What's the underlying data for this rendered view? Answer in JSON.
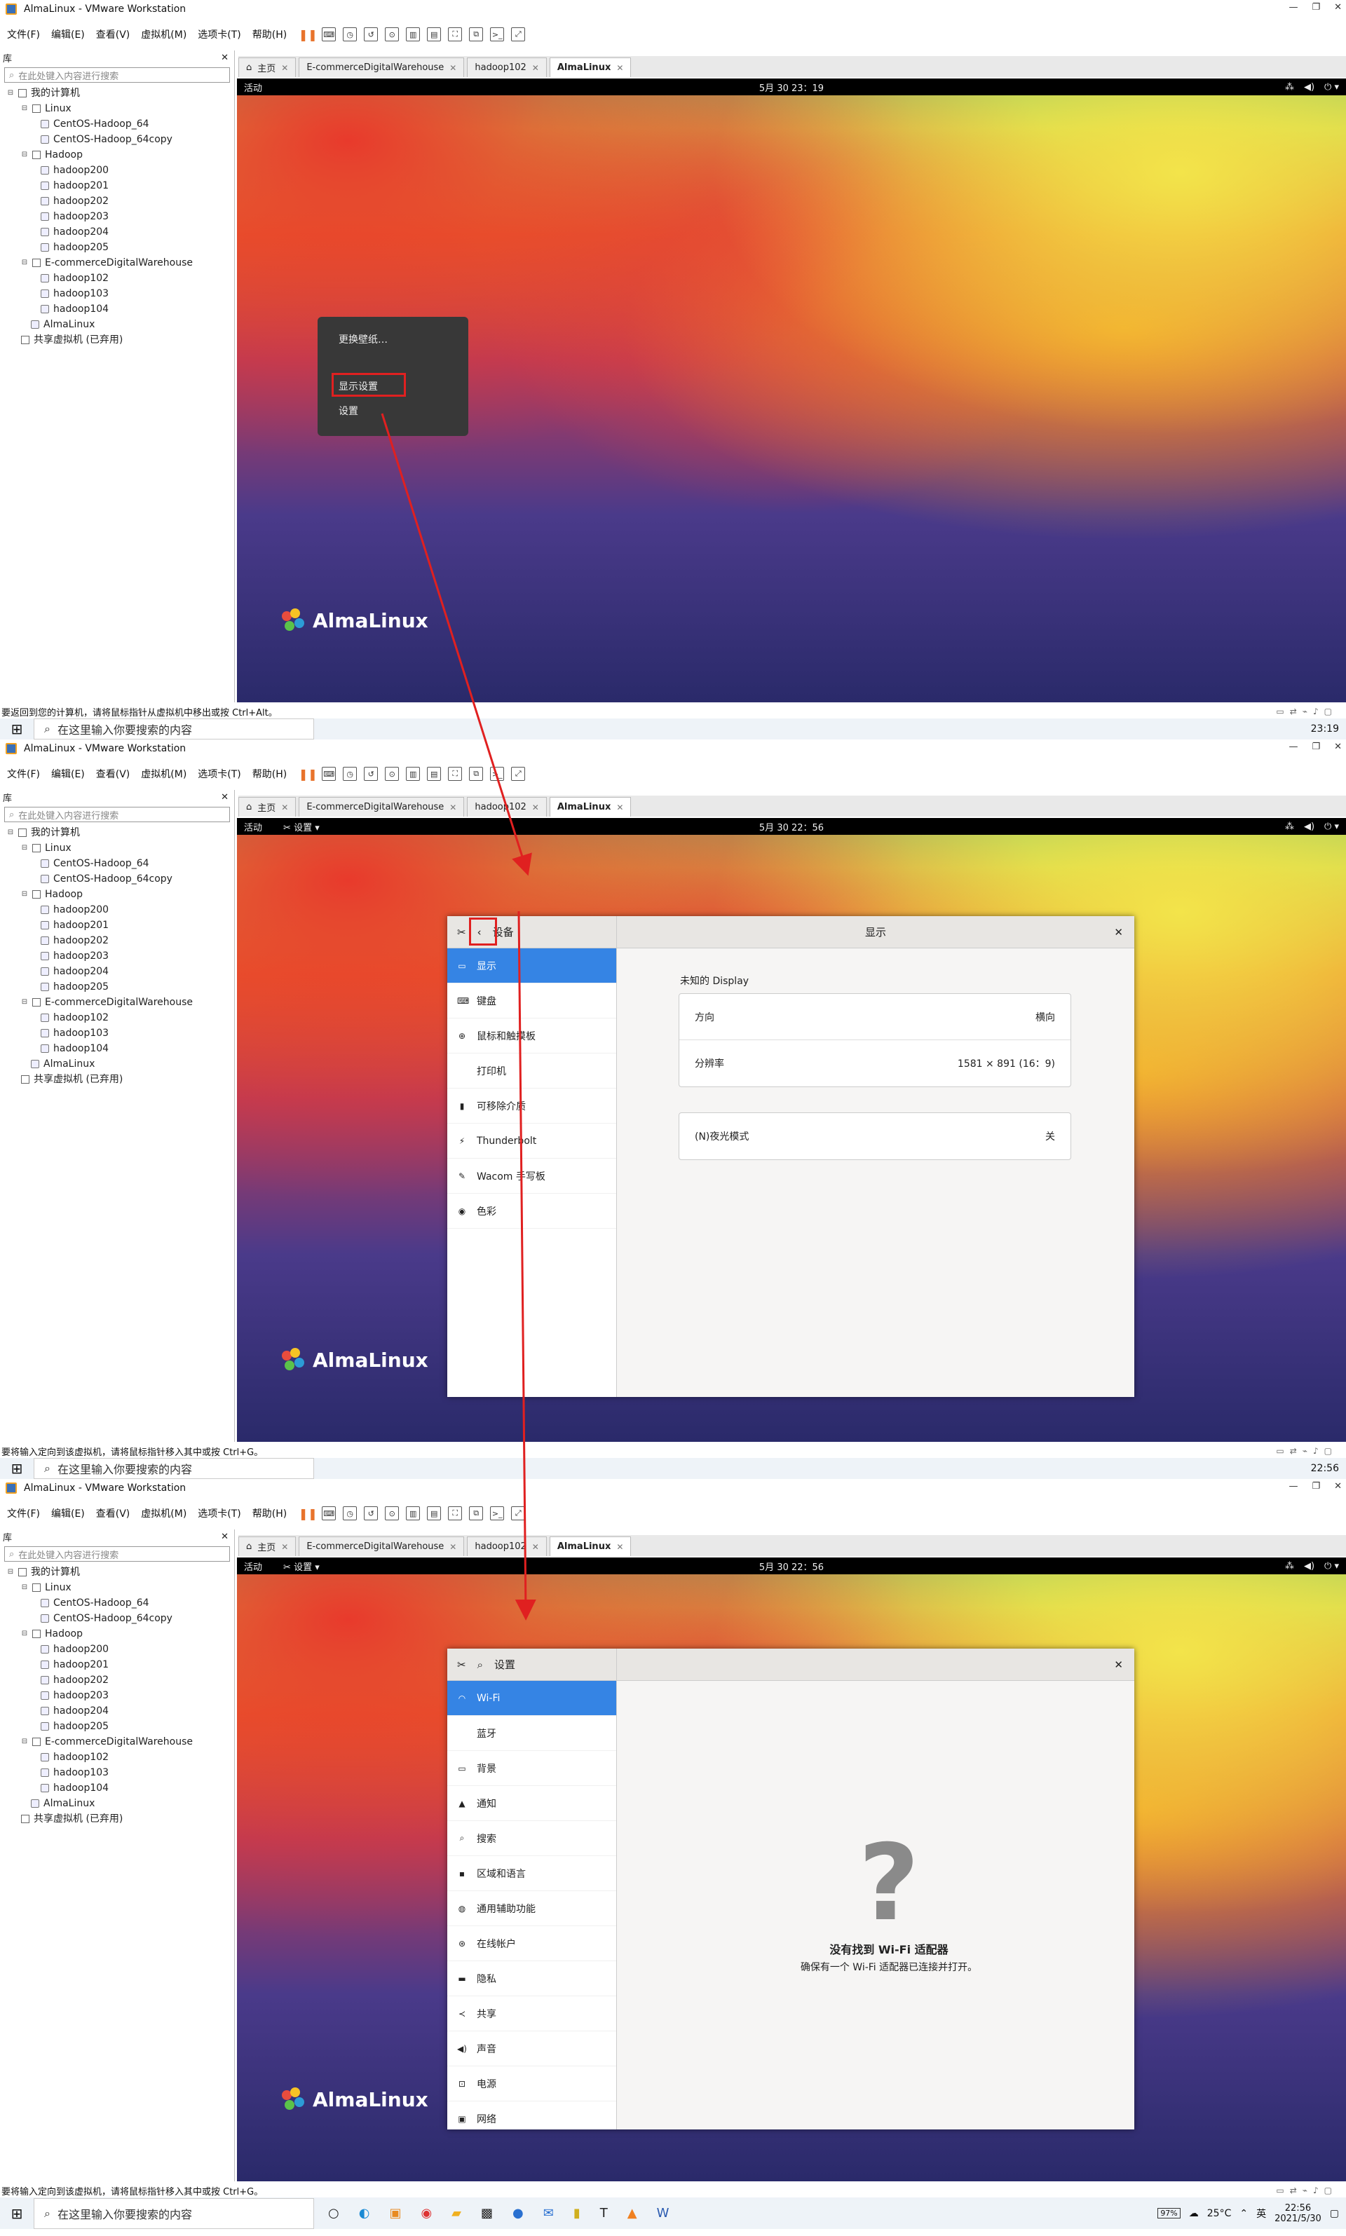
{
  "window_title": "AlmaLinux - VMware Workstation",
  "menu": [
    "文件(F)",
    "编辑(E)",
    "查看(V)",
    "虚拟机(M)",
    "选项卡(T)",
    "帮助(H)"
  ],
  "library": {
    "title": "库",
    "search_placeholder": "在此处键入内容进行搜索",
    "tree": [
      "我的计算机",
      "Linux",
      "CentOS-Hadoop_64",
      "CentOS-Hadoop_64copy",
      "Hadoop",
      "hadoop200",
      "hadoop201",
      "hadoop202",
      "hadoop203",
      "hadoop204",
      "hadoop205",
      "E-commerceDigitalWarehouse",
      "hadoop102",
      "hadoop103",
      "hadoop104",
      "AlmaLinux",
      "共享虚拟机 (已弃用)"
    ]
  },
  "tabs": [
    "主页",
    "E-commerceDigitalWarehouse",
    "hadoop102",
    "AlmaLinux"
  ],
  "guest_bar": {
    "activities": "活动",
    "settings_app": "设置",
    "clock1": "5月 30 23：19",
    "clock2": "5月 30 22：56",
    "clock3": "5月 30 22：56"
  },
  "logo_text": "AlmaLinux",
  "context_menu": [
    "更换壁纸…",
    "显示设置",
    "设置"
  ],
  "display_window": {
    "header_left": "设备",
    "header_title": "显示",
    "sidebar": [
      "显示",
      "键盘",
      "鼠标和触摸板",
      "打印机",
      "可移除介质",
      "Thunderbolt",
      "Wacom 手写板",
      "色彩"
    ],
    "section_title": "未知的 Display",
    "rows": [
      {
        "label": "方向",
        "value": "横向"
      },
      {
        "label": "分辨率",
        "value": "1581 × 891 (16：9)"
      }
    ],
    "night": {
      "label": "(N)夜光模式",
      "value": "关"
    }
  },
  "wifi_window": {
    "header_left": "设置",
    "sidebar": [
      "Wi-Fi",
      "蓝牙",
      "背景",
      "通知",
      "搜索",
      "区域和语言",
      "通用辅助功能",
      "在线帐户",
      "隐私",
      "共享",
      "声音",
      "电源",
      "网络"
    ],
    "empty_title": "没有找到 Wi-Fi 适配器",
    "empty_sub": "确保有一个 Wi-Fi 适配器已连接并打开。"
  },
  "status1": "要返回到您的计算机，请将鼠标指针从虚拟机中移出或按 Ctrl+Alt。",
  "status2": "要将输入定向到该虚拟机，请将鼠标指针移入其中或按 Ctrl+G。",
  "status3": "要将输入定向到该虚拟机，请将鼠标指针移入其中或按 Ctrl+G。",
  "taskbar": {
    "search_placeholder": "在这里输入你要搜索的内容",
    "battery": "97%",
    "weather": "25°C",
    "ime": "英",
    "time1": "23:19",
    "time2": "22:56",
    "time3": "22:56",
    "date3": "2021/5/30"
  }
}
